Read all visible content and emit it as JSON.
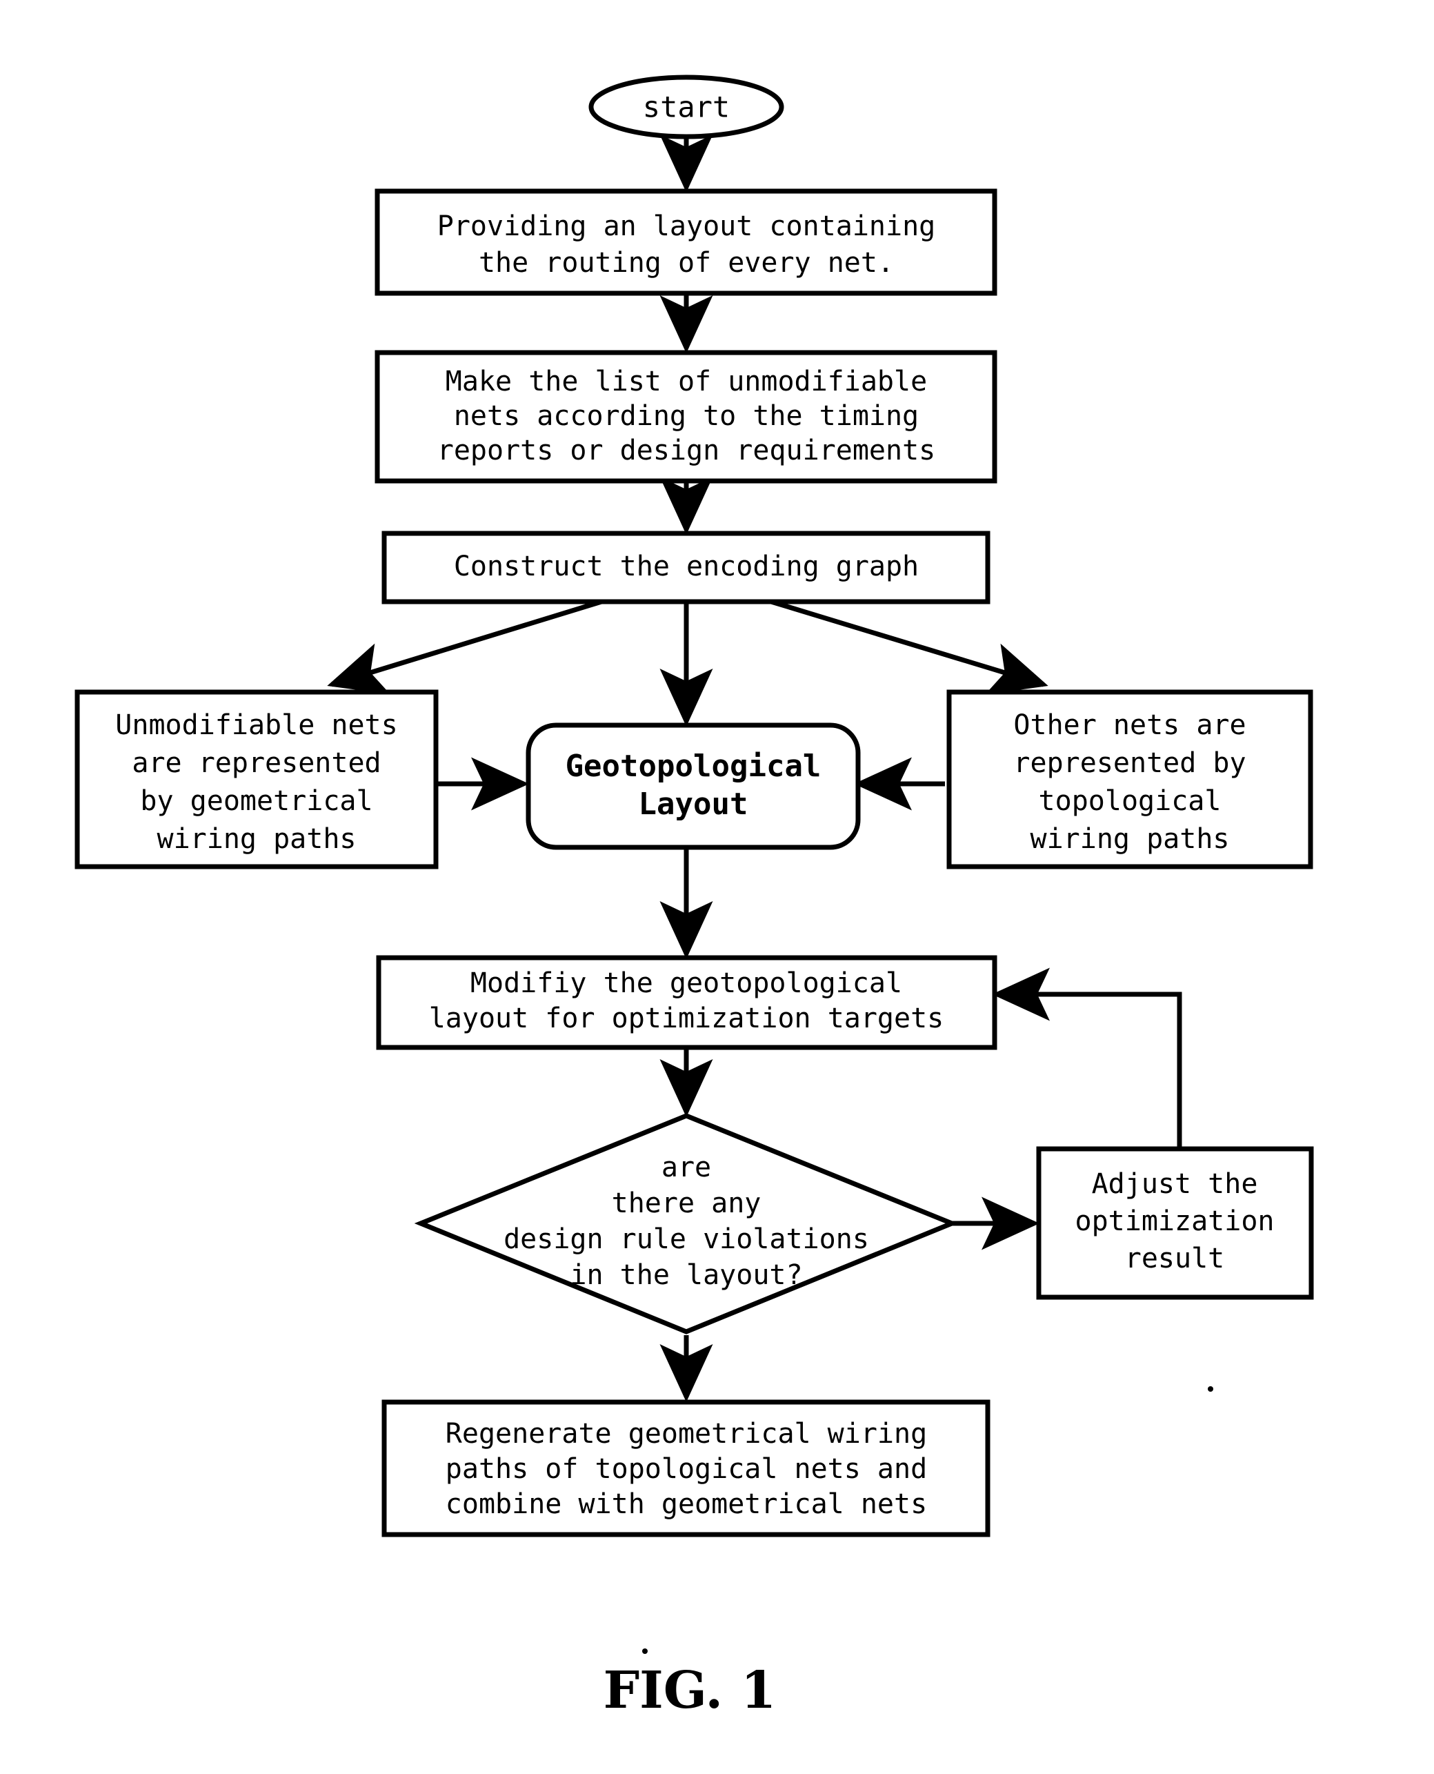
{
  "figure": {
    "caption": "FIG. 1",
    "accent_color": "#000000",
    "background_color": "#ffffff"
  },
  "flowchart": {
    "start": {
      "label": "start",
      "shape": "ellipse"
    },
    "nodes": [
      {
        "id": "provide-layout",
        "shape": "rectangle",
        "lines": [
          "Providing an layout containing",
          "the routing of every net."
        ]
      },
      {
        "id": "make-list",
        "shape": "rectangle",
        "lines": [
          "Make the list of unmodifiable",
          "nets according to the timing",
          "reports or design requirements"
        ]
      },
      {
        "id": "construct-graph",
        "shape": "rectangle",
        "lines": [
          "Construct the encoding graph"
        ]
      },
      {
        "id": "unmodifiable-nets",
        "shape": "rectangle",
        "lines": [
          "Unmodifiable nets",
          "are represented",
          "by geometrical",
          "wiring paths"
        ]
      },
      {
        "id": "geotopological-layout",
        "shape": "rounded-rectangle",
        "emphasis": "bold",
        "lines": [
          "Geotopological",
          "Layout"
        ]
      },
      {
        "id": "other-nets",
        "shape": "rectangle",
        "lines": [
          "Other nets are",
          "represented by",
          "topological",
          "wiring paths"
        ]
      },
      {
        "id": "modify-layout",
        "shape": "rectangle",
        "lines": [
          "Modifiy the geotopological",
          "layout for optimization targets"
        ]
      },
      {
        "id": "drv-decision",
        "shape": "diamond",
        "lines": [
          "are",
          "there any",
          "design rule violations",
          "in the layout?"
        ]
      },
      {
        "id": "adjust-result",
        "shape": "rectangle",
        "lines": [
          "Adjust the",
          "optimization",
          "result"
        ]
      },
      {
        "id": "regenerate-paths",
        "shape": "rectangle",
        "lines": [
          "Regenerate geometrical wiring",
          "paths of topological nets and",
          "combine with geometrical nets"
        ]
      }
    ],
    "edges": [
      {
        "from": "start",
        "to": "provide-layout",
        "style": "straight-down"
      },
      {
        "from": "provide-layout",
        "to": "make-list",
        "style": "straight-down"
      },
      {
        "from": "make-list",
        "to": "construct-graph",
        "style": "straight-down"
      },
      {
        "from": "construct-graph",
        "to": "unmodifiable-nets",
        "style": "diagonal-left"
      },
      {
        "from": "construct-graph",
        "to": "geotopological-layout",
        "style": "straight-down"
      },
      {
        "from": "construct-graph",
        "to": "other-nets",
        "style": "diagonal-right"
      },
      {
        "from": "unmodifiable-nets",
        "to": "geotopological-layout",
        "style": "straight-right"
      },
      {
        "from": "other-nets",
        "to": "geotopological-layout",
        "style": "straight-left"
      },
      {
        "from": "geotopological-layout",
        "to": "modify-layout",
        "style": "straight-down"
      },
      {
        "from": "modify-layout",
        "to": "drv-decision",
        "style": "straight-down"
      },
      {
        "from": "drv-decision",
        "to": "adjust-result",
        "style": "straight-right"
      },
      {
        "from": "adjust-result",
        "to": "modify-layout",
        "style": "feedback-loop"
      },
      {
        "from": "drv-decision",
        "to": "regenerate-paths",
        "style": "straight-down"
      }
    ]
  }
}
